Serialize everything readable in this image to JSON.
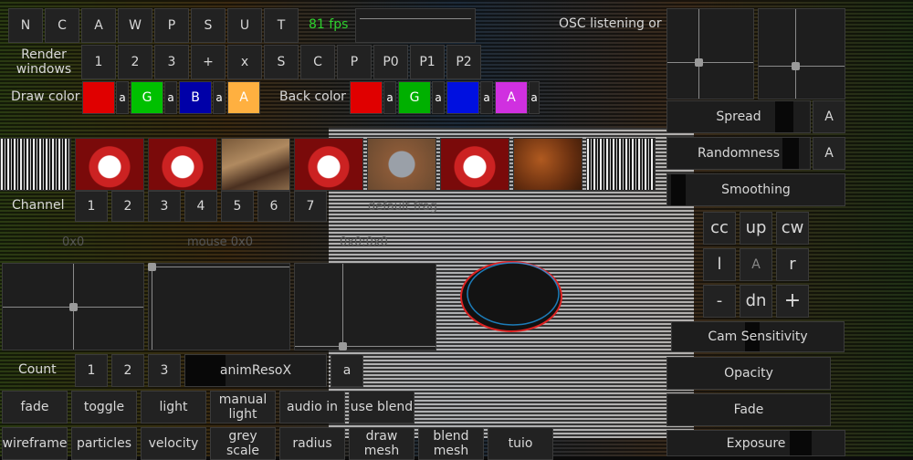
{
  "top_buttons": [
    "N",
    "C",
    "A",
    "W",
    "P",
    "S",
    "U",
    "T"
  ],
  "fps": "81 fps",
  "osc_text": "OSC listening or",
  "render_windows": {
    "label": "Render\nwindows",
    "buttons": [
      "1",
      "2",
      "3",
      "+",
      "x",
      "S",
      "C",
      "P",
      "P0",
      "P1",
      "P2"
    ]
  },
  "draw_color": {
    "label": "Draw color",
    "swatches": [
      {
        "letter": "",
        "color": "#e00000"
      },
      {
        "letter": "a",
        "color": ""
      },
      {
        "letter": "G",
        "color": "#00c000"
      },
      {
        "letter": "a",
        "color": ""
      },
      {
        "letter": "B",
        "color": "#0000a8"
      },
      {
        "letter": "a",
        "color": ""
      },
      {
        "letter": "A",
        "color": "#ffb040"
      }
    ]
  },
  "back_color": {
    "label": "Back color",
    "swatches": [
      {
        "letter": "",
        "color": "#e00000"
      },
      {
        "letter": "a",
        "color": ""
      },
      {
        "letter": "G",
        "color": "#00b000"
      },
      {
        "letter": "a",
        "color": ""
      },
      {
        "letter": "",
        "color": "#0010e0"
      },
      {
        "letter": "a",
        "color": ""
      },
      {
        "letter": "A",
        "color": "#d030e0"
      },
      {
        "letter": "a",
        "color": ""
      }
    ]
  },
  "channel": {
    "label": "Channel",
    "buttons": [
      "1",
      "2",
      "3",
      "4",
      "5",
      "6",
      "7"
    ]
  },
  "readouts": {
    "zero": "0x0",
    "mouse": "mouse 0x0",
    "default_frag": "default frag",
    "channel_hint": "0x0:0x0"
  },
  "count": {
    "label": "Count",
    "buttons": [
      "1",
      "2",
      "3"
    ],
    "anim": "animResoX",
    "a": "a"
  },
  "mode_row1": [
    "fade",
    "toggle",
    "light",
    "manual\nlight",
    "audio in",
    "use blend"
  ],
  "mode_row2": [
    "wireframe",
    "particles",
    "velocity",
    "grey scale",
    "radius",
    "draw\nmesh",
    "blend\nmesh",
    "tuio"
  ],
  "right_sliders": {
    "spread": "Spread",
    "randomness": "Randomness",
    "smoothing": "Smoothing",
    "a": "A"
  },
  "cam": {
    "row1": [
      "cc",
      "up",
      "cw"
    ],
    "row2": [
      "l",
      "A",
      "r"
    ],
    "row3": [
      "-",
      "dn",
      "+"
    ]
  },
  "bottom_sliders": [
    "Cam Sensitivity",
    "Opacity",
    "Fade",
    "Exposure"
  ]
}
